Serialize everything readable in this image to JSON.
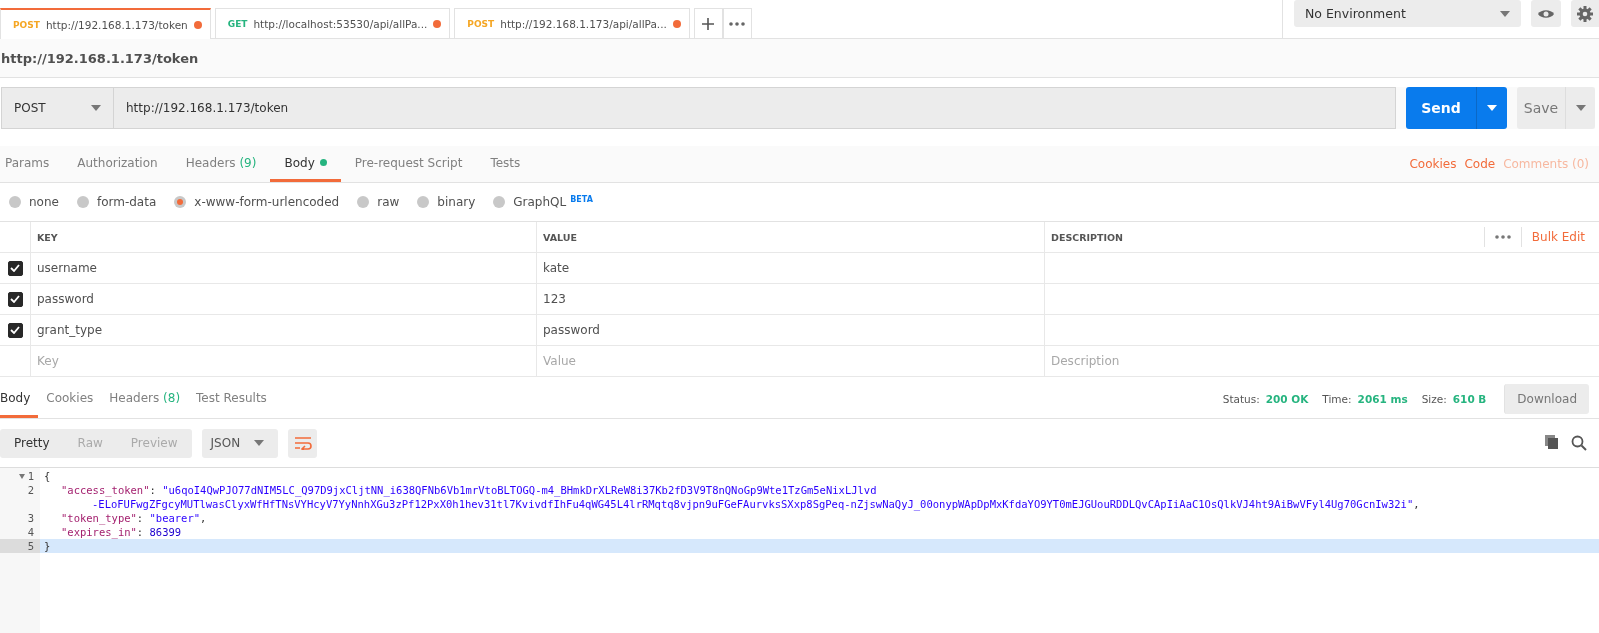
{
  "tabs": [
    {
      "method": "POST",
      "color": "#f5a623",
      "url": "http://192.168.1.173/token",
      "selected": true,
      "unsaved": true
    },
    {
      "method": "GET",
      "color": "#26b47f",
      "url": "http://localhost:53530/api/allPa...",
      "selected": false,
      "unsaved": true
    },
    {
      "method": "POST",
      "color": "#f5a623",
      "url": "http://192.168.1.173/api/allPa...",
      "selected": false,
      "unsaved": true
    }
  ],
  "environment": {
    "label": "No Environment"
  },
  "request_title": "http://192.168.1.173/token",
  "request": {
    "method": "POST",
    "url": "http://192.168.1.173/token",
    "send": "Send",
    "save": "Save"
  },
  "request_tabs": [
    {
      "label": "Params",
      "selected": false,
      "indicator": false
    },
    {
      "label": "Authorization",
      "selected": false,
      "indicator": false
    },
    {
      "label": "Headers",
      "count": "(9)",
      "selected": false,
      "indicator": false
    },
    {
      "label": "Body",
      "selected": true,
      "indicator": true
    },
    {
      "label": "Pre-request Script",
      "selected": false,
      "indicator": false
    },
    {
      "label": "Tests",
      "selected": false,
      "indicator": false
    }
  ],
  "request_links": [
    {
      "label": "Cookies",
      "disabled": false
    },
    {
      "label": "Code",
      "disabled": false
    },
    {
      "label": "Comments (0)",
      "disabled": true
    }
  ],
  "body_types": [
    {
      "label": "none",
      "selected": false
    },
    {
      "label": "form-data",
      "selected": false
    },
    {
      "label": "x-www-form-urlencoded",
      "selected": true
    },
    {
      "label": "raw",
      "selected": false
    },
    {
      "label": "binary",
      "selected": false
    },
    {
      "label": "GraphQL",
      "badge": "BETA",
      "selected": false
    }
  ],
  "params_table": {
    "columns": [
      "KEY",
      "VALUE",
      "DESCRIPTION"
    ],
    "bulk_edit": "Bulk Edit",
    "rows": [
      {
        "checked": true,
        "key": "username",
        "value": "kate"
      },
      {
        "checked": true,
        "key": "password",
        "value": "123"
      },
      {
        "checked": true,
        "key": "grant_type",
        "value": "password"
      }
    ],
    "placeholders": {
      "key": "Key",
      "value": "Value",
      "description": "Description"
    }
  },
  "response": {
    "tabs": [
      {
        "label": "Body",
        "selected": true
      },
      {
        "label": "Cookies",
        "selected": false
      },
      {
        "label": "Headers",
        "count": "(8)",
        "selected": false
      },
      {
        "label": "Test Results",
        "selected": false
      }
    ],
    "stats": [
      {
        "label": "Status:",
        "value": "200 OK"
      },
      {
        "label": "Time:",
        "value": "2061 ms"
      },
      {
        "label": "Size:",
        "value": "610 B"
      }
    ],
    "download": "Download",
    "view_modes": [
      {
        "label": "Pretty",
        "selected": true
      },
      {
        "label": "Raw",
        "selected": false
      },
      {
        "label": "Preview",
        "selected": false
      }
    ],
    "format": "JSON",
    "code_lines": [
      {
        "number": "1",
        "foldable": true,
        "active": false,
        "segments": [
          {
            "kind": "punct",
            "text": "{"
          }
        ]
      },
      {
        "number": "2",
        "foldable": false,
        "active": false,
        "segments": [
          {
            "kind": "key",
            "text": "\"access_token\""
          },
          {
            "kind": "punct",
            "text": ": "
          },
          {
            "kind": "string",
            "text": "\"u6qoI4QwPJO77dNIM5LC_Q97D9jxCljtNN_i638QFNb6Vb1mrVtoBLTOGQ-m4_BHmkDrXLReW8i37Kb2fD3V9T8nQNoGp9Wte1TzGm5eNixLJlvd"
          }
        ],
        "continuation": [
          {
            "kind": "string",
            "text": "-ELoFUFwgZFgcyMUTlwasClyxWfHfTNsVYHcyV7YyNnhXGu3zPf12PxX0h1hev31tl7KvivdfIhFu4qWG45L4lrRMqtq8vjpn9uFGeFAurvksSXxp8SgPeq-nZjswNaQyJ_00onypWApDpMxKfdaYO9YT0mEJGUouRDDLQvCApIiAaC1OsQlkVJ4ht9AiBwVFyl4Ug70GcnIw32i\""
          },
          {
            "kind": "punct",
            "text": ","
          }
        ]
      },
      {
        "number": "3",
        "foldable": false,
        "active": false,
        "segments": [
          {
            "kind": "key",
            "text": "\"token_type\""
          },
          {
            "kind": "punct",
            "text": ": "
          },
          {
            "kind": "string",
            "text": "\"bearer\""
          },
          {
            "kind": "punct",
            "text": ","
          }
        ]
      },
      {
        "number": "4",
        "foldable": false,
        "active": false,
        "segments": [
          {
            "kind": "key",
            "text": "\"expires_in\""
          },
          {
            "kind": "punct",
            "text": ": "
          },
          {
            "kind": "number",
            "text": "86399"
          }
        ]
      },
      {
        "number": "5",
        "foldable": false,
        "active": true,
        "segments": [
          {
            "kind": "punct",
            "text": "}"
          }
        ]
      }
    ]
  }
}
